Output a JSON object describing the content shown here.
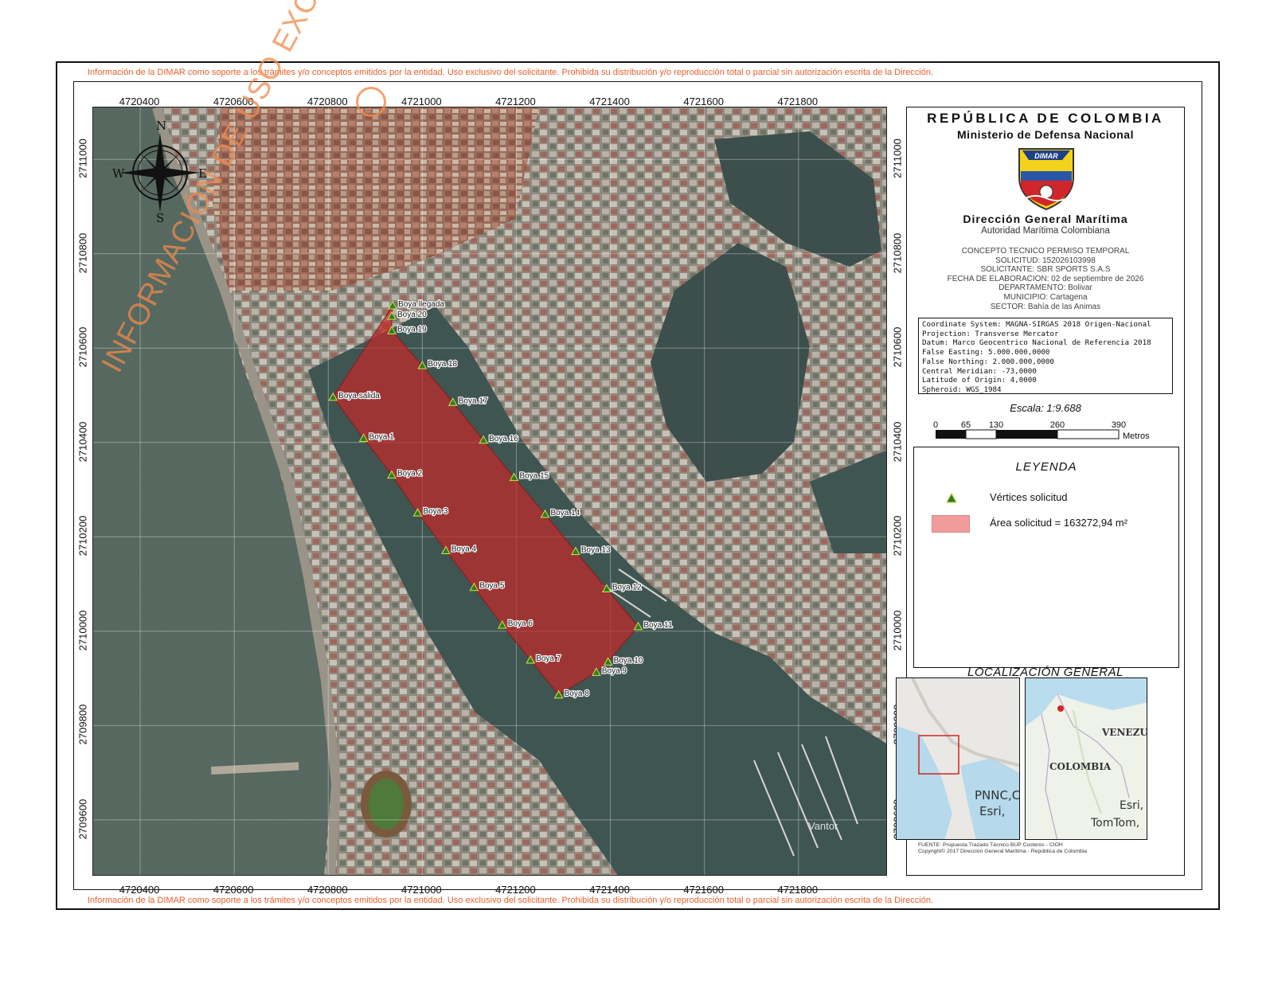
{
  "disclaimer": "Información de la DIMAR como soporte a los trámites y/o conceptos emitidos por la entidad. Uso exclusivo del solicitante. Prohibida su distribución y/o reproducción total o parcial sin autorización escrita de la Dirección.",
  "watermark": "INFORMACIÓN DE USO EXCLUSIVO",
  "axes": {
    "x_ticks": [
      "4720400",
      "4720600",
      "4720800",
      "4721000",
      "4721200",
      "4721400",
      "4721600",
      "4721800"
    ],
    "y_ticks": [
      "2711000",
      "2710800",
      "2710600",
      "2710400",
      "2710200",
      "2710000",
      "2709800",
      "2709600"
    ]
  },
  "compass": {
    "n": "N",
    "s": "S",
    "e": "E",
    "w": "W"
  },
  "map": {
    "vendor_label": "Vantor",
    "buoys": [
      {
        "label": "Boya llegada",
        "x": 4720937,
        "y": 2710690
      },
      {
        "label": "Boya 20",
        "x": 4720935,
        "y": 2710668
      },
      {
        "label": "Boya 19",
        "x": 4720935,
        "y": 2710637
      },
      {
        "label": "Boya 18",
        "x": 4721000,
        "y": 2710563
      },
      {
        "label": "Boya 17",
        "x": 4721065,
        "y": 2710485
      },
      {
        "label": "Boya 16",
        "x": 4721130,
        "y": 2710405
      },
      {
        "label": "Boya 15",
        "x": 4721195,
        "y": 2710326
      },
      {
        "label": "Boya 14",
        "x": 4721261,
        "y": 2710248
      },
      {
        "label": "Boya 13",
        "x": 4721326,
        "y": 2710169
      },
      {
        "label": "Boya 12",
        "x": 4721392,
        "y": 2710090
      },
      {
        "label": "Boya 11",
        "x": 4721459,
        "y": 2710010
      },
      {
        "label": "Boya 10",
        "x": 4721395,
        "y": 2709935
      },
      {
        "label": "Boya 9",
        "x": 4721370,
        "y": 2709913
      },
      {
        "label": "Boya 8",
        "x": 4721290,
        "y": 2709865
      },
      {
        "label": "Boya 7",
        "x": 4721230,
        "y": 2709939
      },
      {
        "label": "Boya 6",
        "x": 4721170,
        "y": 2710013
      },
      {
        "label": "Boya 5",
        "x": 4721110,
        "y": 2710093
      },
      {
        "label": "Boya 4",
        "x": 4721050,
        "y": 2710171
      },
      {
        "label": "Boya 3",
        "x": 4720990,
        "y": 2710251
      },
      {
        "label": "Boya 2",
        "x": 4720935,
        "y": 2710331
      },
      {
        "label": "Boya 1",
        "x": 4720875,
        "y": 2710409
      },
      {
        "label": "Boya salida",
        "x": 4720810,
        "y": 2710496
      }
    ]
  },
  "panel": {
    "republica": "REPÚBLICA DE COLOMBIA",
    "ministerio": "Ministerio de Defensa Nacional",
    "logo_text": "DIMAR",
    "direccion": "Dirección General Marítima",
    "autoridad": "Autoridad Marítima Colombiana",
    "info": [
      "CONCEPTO TECNICO PERMISO TEMPORAL",
      "SOLICITUD: 152026103998",
      "SOLICITANTE: SBR SPORTS S.A.S",
      "FECHA DE ELABORACION: 02 de septiembre de 2026",
      "DEPARTAMENTO: Bolivar",
      "MUNICIPIO: Cartagena",
      "SECTOR: Bahía de las Animas"
    ],
    "coords": [
      "Coordinate System: MAGNA-SIRGAS 2018 Origen-Nacional",
      "Projection: Transverse Mercator",
      "Datum: Marco Geocentrico Nacional de Referencia 2018",
      "False Easting: 5.000.000,0000",
      "False Northing: 2.000.000,0000",
      "Central Meridian: -73,0000",
      "Latitude of Origin: 4,0000",
      "Spheroid: WGS_1984"
    ],
    "escala": "Escala: 1:9.688",
    "scale_ticks": [
      "0",
      "65",
      "130",
      "260",
      "390"
    ],
    "scale_unit": "Metros",
    "legend_title": "LEYENDA",
    "legend_items": [
      "Vértices solicitud",
      "Área solicitud = 163272,94 m²"
    ],
    "loc_title": "LOCALIZACIÓN GENERAL",
    "loc_left_labels": [
      "PNNC,C",
      "Esri,"
    ],
    "loc_right_labels": [
      "VENEZU",
      "COLOMBIA",
      "Esri,",
      "TomTom,"
    ],
    "fuente": [
      "FUENTE: Propuesta Trazado Técnico BUP Costeros - CIOH",
      "Copyright© 2017 Dirección General Marítima - República de Colombia"
    ]
  },
  "colors": {
    "area_fill": "#c22a2a",
    "disclaimer": "#e8602c",
    "watermark": "#f08a4b",
    "water": "#3f5552"
  }
}
